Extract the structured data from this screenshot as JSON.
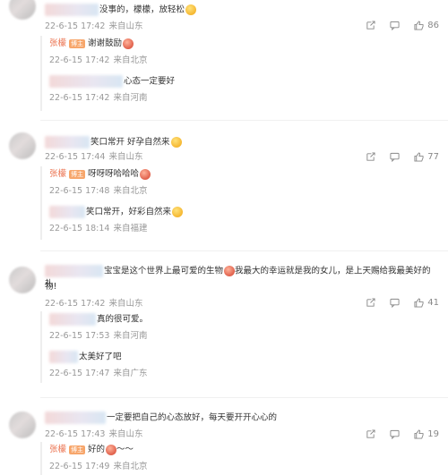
{
  "comments": [
    {
      "text": "没事的，檬檬，放轻松",
      "meta": {
        "date": "22-6-15 17:42",
        "location": "来自山东"
      },
      "likes": "86",
      "replies": [
        {
          "author": "张檬",
          "badge": "博主",
          "text": "谢谢鼓励",
          "meta": {
            "date": "22-6-15 17:42",
            "location": "来自北京"
          }
        },
        {
          "author": "",
          "text": "心态一定要好",
          "meta": {
            "date": "22-6-15 17:42",
            "location": "来自河南"
          }
        }
      ]
    },
    {
      "text": "笑口常开 好孕自然来",
      "meta": {
        "date": "22-6-15 17:44",
        "location": "来自山东"
      },
      "likes": "77",
      "replies": [
        {
          "author": "张檬",
          "badge": "博主",
          "text": "呀呀呀哈哈哈",
          "meta": {
            "date": "22-6-15 17:48",
            "location": "来自北京"
          }
        },
        {
          "author": "",
          "text": "笑口常开，好彩自然来",
          "meta": {
            "date": "22-6-15 18:14",
            "location": "来自福建"
          }
        }
      ]
    },
    {
      "text": "宝宝是这个世界上最可爱的生物",
      "text2": "我最大的幸运就是我的女儿，是上天赐给我最美好的礼",
      "text3": "物!",
      "meta": {
        "date": "22-6-15 17:42",
        "location": "来自山东"
      },
      "likes": "41",
      "replies": [
        {
          "author": "",
          "text": "真的很可爱。",
          "meta": {
            "date": "22-6-15 17:53",
            "location": "来自河南"
          }
        },
        {
          "author": "",
          "text": "太美好了吧",
          "meta": {
            "date": "22-6-15 17:47",
            "location": "来自广东"
          }
        }
      ]
    },
    {
      "text": "一定要把自己的心态放好，每天要开开心心的",
      "meta": {
        "date": "22-6-15 17:43",
        "location": "来自山东"
      },
      "likes": "19",
      "replies": [
        {
          "author": "张檬",
          "badge": "博主",
          "text": "好的",
          "text_suffix": "～～",
          "meta": {
            "date": "22-6-15 17:49",
            "location": "来自北京"
          }
        }
      ]
    }
  ],
  "icons": {
    "share": "share-icon",
    "comment": "comment-icon",
    "like": "thumbs-up-icon"
  }
}
